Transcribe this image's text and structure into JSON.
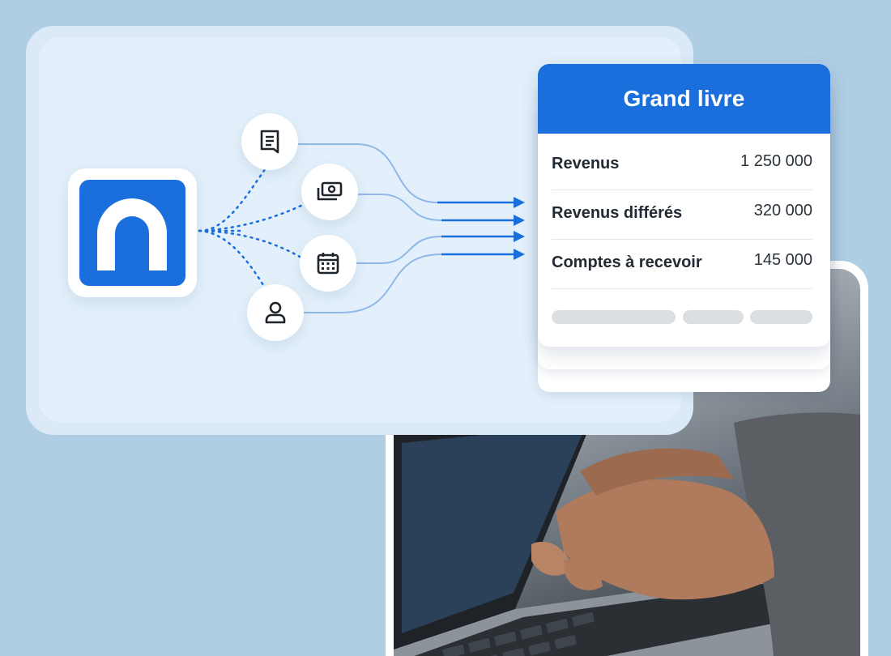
{
  "ledger": {
    "title": "Grand livre",
    "rows": [
      {
        "label": "Revenus",
        "value": "1 250 000"
      },
      {
        "label": "Revenus différés",
        "value": "320 000"
      },
      {
        "label": "Comptes à recevoir",
        "value": "145 000"
      }
    ]
  },
  "flow": {
    "nodes": [
      {
        "icon": "document-icon"
      },
      {
        "icon": "money-icon"
      },
      {
        "icon": "calendar-icon"
      },
      {
        "icon": "user-icon"
      }
    ]
  },
  "colors": {
    "background": "#afcde3",
    "brand_blue": "#1a6fdd",
    "panel": "#e3f0fb",
    "wire": "#8fb8e8"
  }
}
